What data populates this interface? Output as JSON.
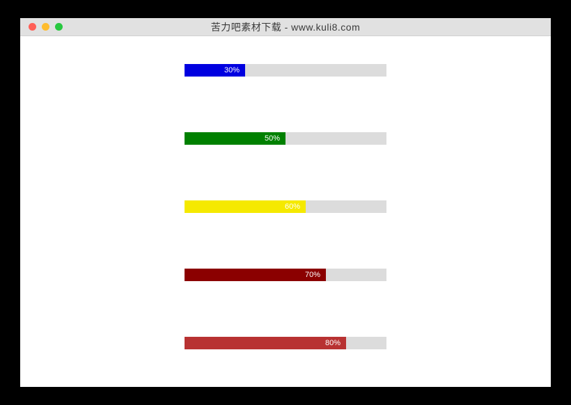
{
  "window": {
    "title": "苦力吧素材下载 - www.kuli8.com"
  },
  "progress_bars": [
    {
      "value": 30,
      "label": "30%",
      "color": "#0000e0"
    },
    {
      "value": 50,
      "label": "50%",
      "color": "#008000"
    },
    {
      "value": 60,
      "label": "60%",
      "color": "#f5e900"
    },
    {
      "value": 70,
      "label": "70%",
      "color": "#8b0000"
    },
    {
      "value": 80,
      "label": "80%",
      "color": "#b83232"
    }
  ]
}
